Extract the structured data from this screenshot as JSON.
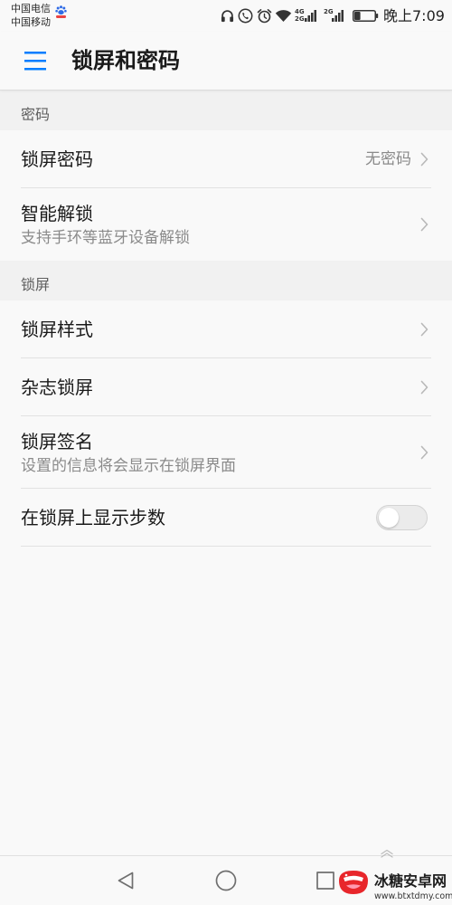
{
  "status_bar": {
    "carrier_primary": "中国电信",
    "carrier_secondary": "中国移动",
    "network_1_top": "4G",
    "network_1_bottom": "2G",
    "network_2": "2G",
    "time": "晚上7:09",
    "battery_level": 0.3,
    "icons": [
      "baidu-paw-icon",
      "headset-icon",
      "hd-voice-icon",
      "alarm-icon",
      "wifi-icon",
      "signal-icon",
      "signal-icon",
      "battery-icon"
    ]
  },
  "header": {
    "menu_icon": "menu-icon",
    "title": "锁屏和密码"
  },
  "sections": [
    {
      "title": "密码",
      "items": [
        {
          "title": "锁屏密码",
          "value": "无密码",
          "icon": "chevron-right-icon"
        },
        {
          "title": "智能解锁",
          "subtitle": "支持手环等蓝牙设备解锁",
          "icon": "chevron-right-icon"
        }
      ]
    },
    {
      "title": "锁屏",
      "items": [
        {
          "title": "锁屏样式",
          "icon": "chevron-right-icon"
        },
        {
          "title": "杂志锁屏",
          "icon": "chevron-right-icon"
        },
        {
          "title": "锁屏签名",
          "subtitle": "设置的信息将会显示在锁屏界面",
          "icon": "chevron-right-icon"
        },
        {
          "title": "在锁屏上显示步数",
          "toggle_on": false
        }
      ]
    }
  ],
  "nav_bar": {
    "icons": [
      "back-icon",
      "home-icon",
      "recents-icon",
      "expand-up-icon"
    ]
  },
  "watermark": {
    "logo_icon": "btxtdmy-logo-icon",
    "name": "冰糖安卓网",
    "url": "www.btxtdmy.com"
  },
  "colors": {
    "accent": "#007dff",
    "background": "#f9f9f9",
    "section_background": "#f1f1f1",
    "primary_text": "#1a1a1a",
    "secondary_text": "#8a8a8a",
    "section_text": "#5e5e5e",
    "divider": "#e2e2e2",
    "icon_dark": "#333333",
    "icon_gray": "#6f6f6f",
    "chevron": "#b8b8b8",
    "toggle_track": "#ebebeb",
    "toggle_border": "#d3d3d3",
    "brand_red": "#e8262b"
  }
}
